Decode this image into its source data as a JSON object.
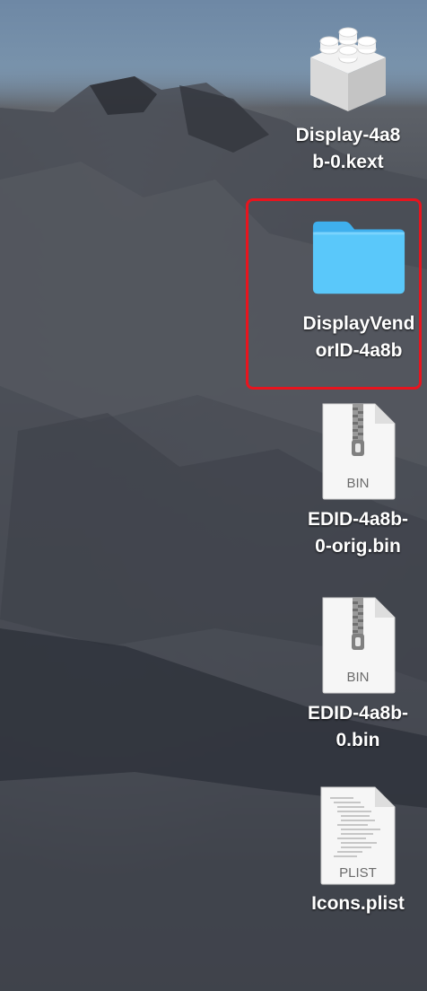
{
  "desktop": {
    "icons": [
      {
        "label": "Display-4a8\nb-0.kext",
        "icon": "kext-bundle-icon",
        "selected": false
      },
      {
        "label": "DisplayVend\norID-4a8b",
        "icon": "folder-icon",
        "selected": true
      },
      {
        "label": "EDID-4a8b-\n0-orig.bin",
        "icon": "zip-document-icon",
        "badge": "BIN",
        "selected": false
      },
      {
        "label": "EDID-4a8b-\n0.bin",
        "icon": "zip-document-icon",
        "badge": "BIN",
        "selected": false
      },
      {
        "label": "Icons.plist",
        "icon": "plist-document-icon",
        "badge": "PLIST",
        "selected": false
      }
    ]
  },
  "colors": {
    "selection_outline": "#e8141e",
    "folder_blue": "#5ac8fa",
    "label_text": "#ffffff"
  }
}
